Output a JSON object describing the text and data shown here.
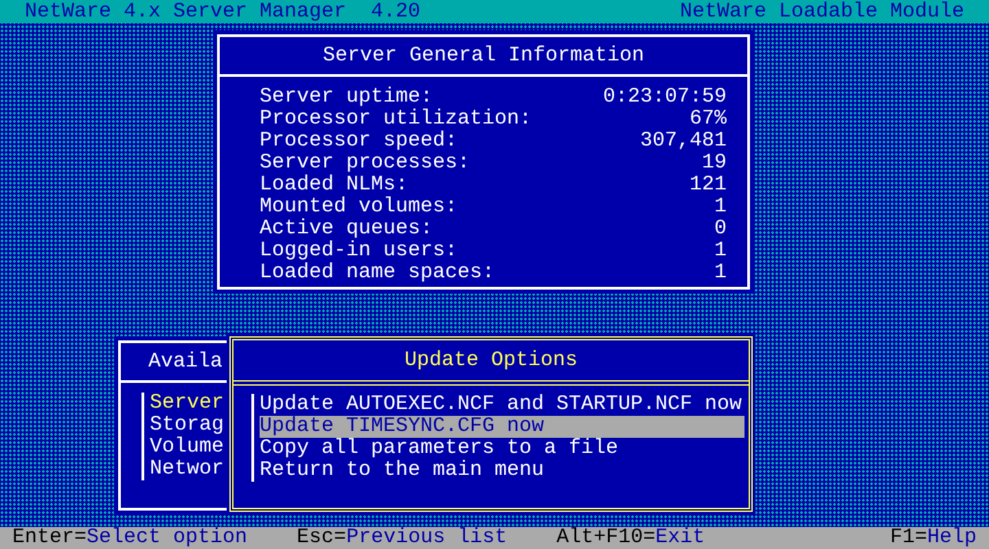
{
  "title_bar": {
    "title": "NetWare 4.x Server Manager  4.20",
    "module": "NetWare Loadable Module"
  },
  "info_window": {
    "title": "Server General Information",
    "rows": [
      {
        "label": "Server uptime:",
        "value": "0:23:07:59"
      },
      {
        "label": "Processor utilization:",
        "value": "67%"
      },
      {
        "label": "Processor speed:",
        "value": "307,481"
      },
      {
        "label": "Server processes:",
        "value": "19"
      },
      {
        "label": "Loaded NLMs:",
        "value": "121"
      },
      {
        "label": "Mounted volumes:",
        "value": "1"
      },
      {
        "label": "Active queues:",
        "value": "0"
      },
      {
        "label": "Logged-in users:",
        "value": "1"
      },
      {
        "label": "Loaded name spaces:",
        "value": "1"
      }
    ]
  },
  "available_window": {
    "title": "Availa",
    "items": [
      {
        "label": "Server",
        "selected": true
      },
      {
        "label": "Storag",
        "selected": false
      },
      {
        "label": "Volume",
        "selected": false
      },
      {
        "label": "Networ",
        "selected": false
      }
    ]
  },
  "update_window": {
    "title": "Update Options",
    "items": [
      {
        "label": "Update AUTOEXEC.NCF and STARTUP.NCF now",
        "selected": false
      },
      {
        "label": "Update TIMESYNC.CFG now",
        "selected": true
      },
      {
        "label": "Copy all parameters to a file",
        "selected": false
      },
      {
        "label": "Return to the main menu",
        "selected": false
      }
    ]
  },
  "status_bar": [
    {
      "key": "Enter=",
      "action": "Select option"
    },
    {
      "key": "Esc=",
      "action": "Previous list"
    },
    {
      "key": "Alt+F10=",
      "action": "Exit"
    },
    {
      "key": "F1=",
      "action": "Help"
    }
  ]
}
